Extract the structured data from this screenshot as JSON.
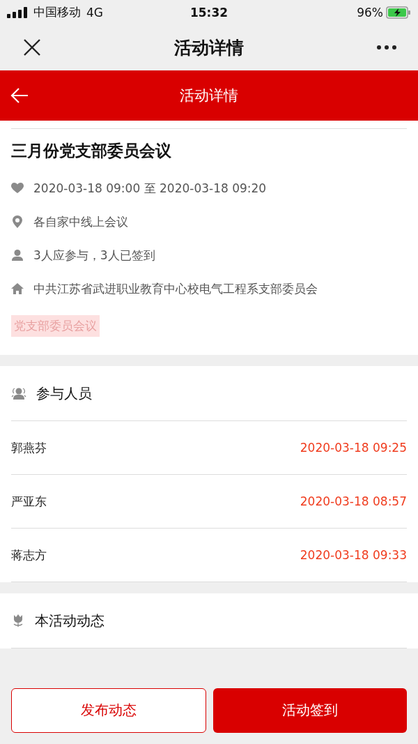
{
  "status_bar": {
    "carrier": "中国移动",
    "network": "4G",
    "time": "15:32",
    "battery": "96%"
  },
  "nav_bar": {
    "title": "活动详情"
  },
  "header": {
    "title": "活动详情"
  },
  "activity": {
    "title": "三月份党支部委员会议",
    "info": [
      {
        "kind": "time",
        "text": "2020-03-18 09:00 至 2020-03-18 09:20"
      },
      {
        "kind": "place",
        "text": "各自家中线上会议"
      },
      {
        "kind": "people",
        "text": "3人应参与，3人已签到"
      },
      {
        "kind": "org",
        "text": "中共江苏省武进职业教育中心校电气工程系支部委员会"
      }
    ],
    "tag": "党支部委员会议"
  },
  "participants": {
    "title": "参与人员",
    "rows": [
      {
        "name": "郭燕芬",
        "time": "2020-03-18 09:25"
      },
      {
        "name": "严亚东",
        "time": "2020-03-18 08:57"
      },
      {
        "name": "蒋志方",
        "time": "2020-03-18 09:33"
      }
    ]
  },
  "dynamics": {
    "title": "本活动动态"
  },
  "buttons": [
    {
      "kind": "outline",
      "label": "发布动态"
    },
    {
      "kind": "solid",
      "label": "活动签到"
    }
  ]
}
